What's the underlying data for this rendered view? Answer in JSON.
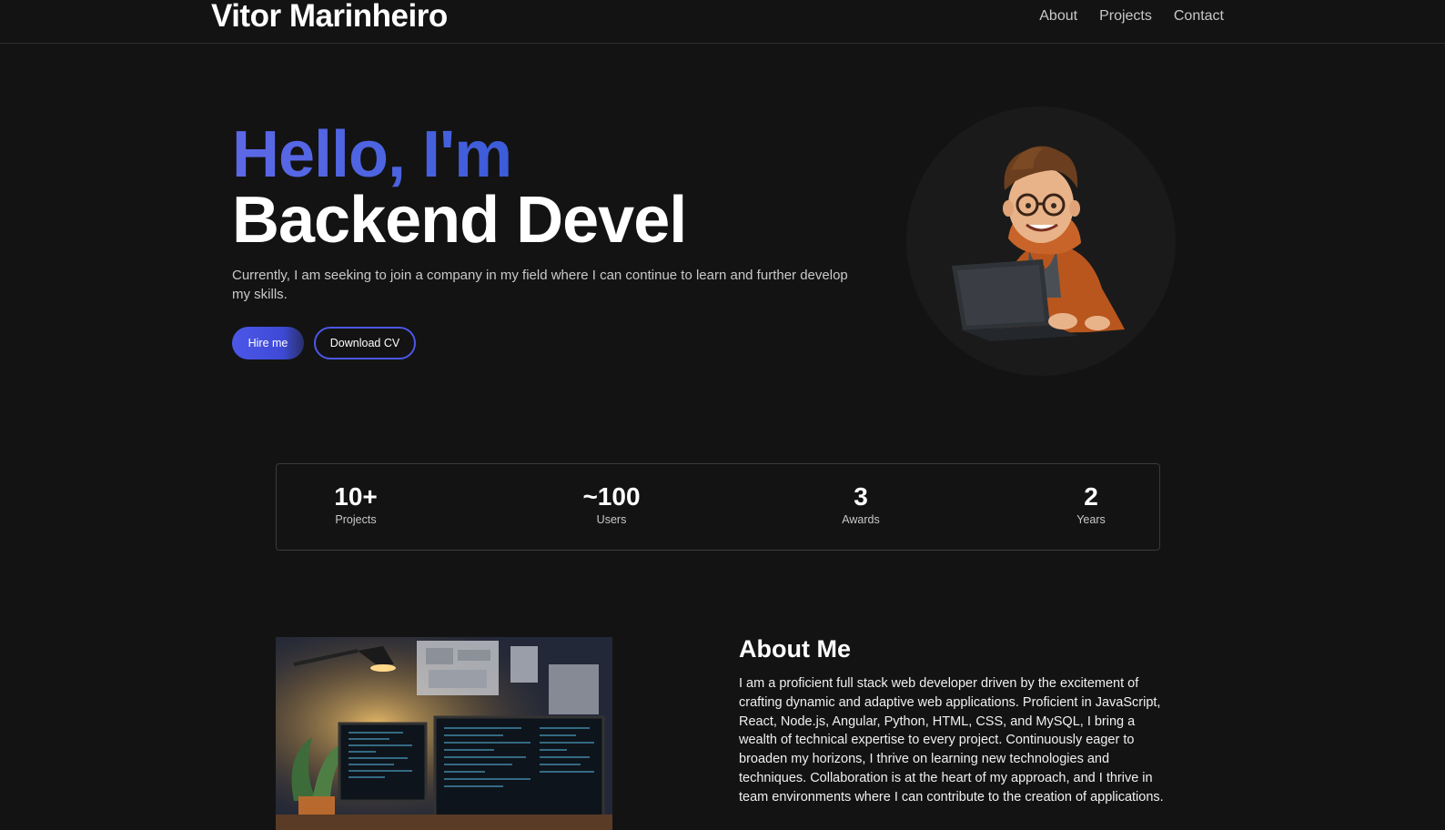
{
  "header": {
    "brand": "Vitor Marinheiro",
    "nav": [
      {
        "label": "About"
      },
      {
        "label": "Projects"
      },
      {
        "label": "Contact"
      }
    ]
  },
  "hero": {
    "greeting": "Hello, I'm",
    "role": "Backend Devel",
    "description": "Currently, I am seeking to join a company in my field where I can continue to learn and further develop my skills.",
    "hire_label": "Hire me",
    "cv_label": "Download CV",
    "avatar_icon": "developer-avatar-illustration"
  },
  "stats": [
    {
      "value": "10+",
      "label": "Projects"
    },
    {
      "value": "~100",
      "label": "Users"
    },
    {
      "value": "3",
      "label": "Awards"
    },
    {
      "value": "2",
      "label": "Years"
    }
  ],
  "about": {
    "title": "About Me",
    "text": "I am a proficient full stack web developer driven by the excitement of crafting dynamic and adaptive web applications. Proficient in JavaScript, React, Node.js, Angular, Python, HTML, CSS, and MySQL, I bring a wealth of technical expertise to every project. Continuously eager to broaden my horizons, I thrive on learning new technologies and techniques. Collaboration is at the heart of my approach, and I thrive in team environments where I can contribute to the creation of applications.",
    "image_icon": "workspace-illustration"
  },
  "colors": {
    "background": "#131313",
    "accent": "#4c57e8",
    "greeting_gradient": "#5d68e6"
  }
}
